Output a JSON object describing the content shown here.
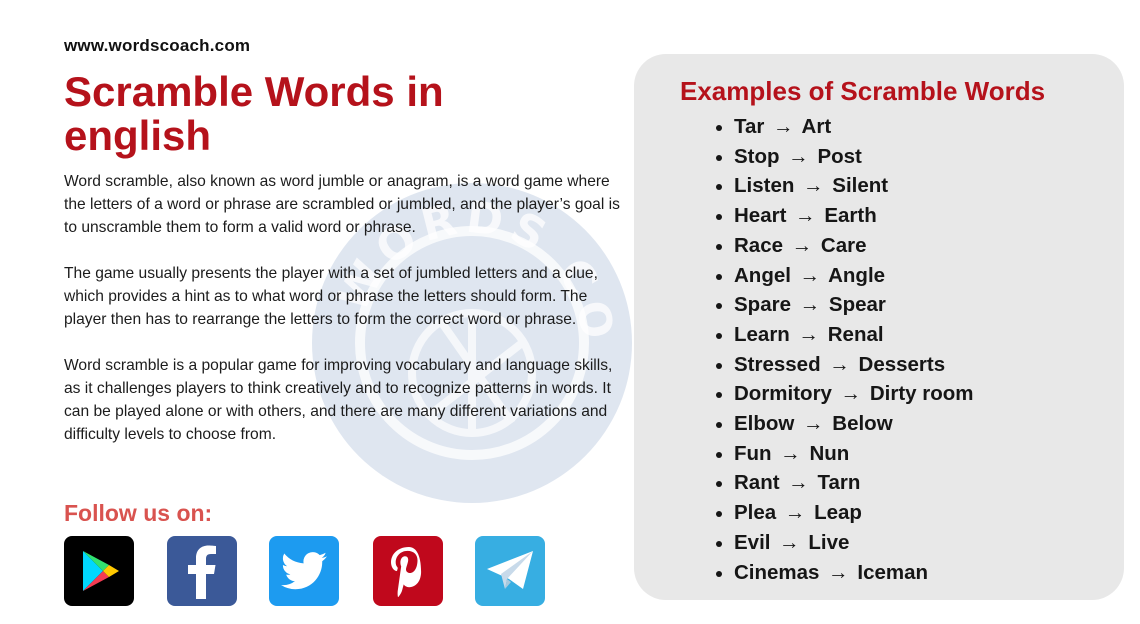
{
  "site": {
    "url": "www.wordscoach.com"
  },
  "header": {
    "title": "Scramble Words in english"
  },
  "article": {
    "paragraphs": [
      "Word scramble, also known as word jumble or anagram, is a word game where the letters of a word or phrase are scrambled or jumbled, and the player’s goal is to unscramble them to form a valid word or phrase.",
      "The game usually presents the player with a set of jumbled letters and a clue, which provides a hint as to what word or phrase the letters should form. The player then has to rearrange the letters to form the correct word or phrase.",
      "Word scramble is a popular game for improving vocabulary and language skills, as it challenges players to think creatively and to recognize patterns in words. It can be played alone or with others, and there are many different variations and difficulty levels to choose from."
    ]
  },
  "follow": {
    "label": "Follow us on:",
    "icons": [
      {
        "name": "google-play-icon",
        "color": "#000000"
      },
      {
        "name": "facebook-icon",
        "color": "#3b5998"
      },
      {
        "name": "twitter-icon",
        "color": "#1d9bf0"
      },
      {
        "name": "pinterest-icon",
        "color": "#c0081c"
      },
      {
        "name": "telegram-icon",
        "color": "#37aee2"
      }
    ]
  },
  "examples": {
    "title": "Examples of Scramble Words",
    "arrow": "→",
    "items": [
      {
        "from": "Tar",
        "to": "Art"
      },
      {
        "from": "Stop",
        "to": "Post"
      },
      {
        "from": "Listen",
        "to": "Silent"
      },
      {
        "from": "Heart",
        "to": "Earth"
      },
      {
        "from": "Race",
        "to": "Care"
      },
      {
        "from": "Angel",
        "to": "Angle"
      },
      {
        "from": "Spare",
        "to": "Spear"
      },
      {
        "from": "Learn",
        "to": "Renal"
      },
      {
        "from": "Stressed",
        "to": "Desserts"
      },
      {
        "from": "Dormitory",
        "to": "Dirty room"
      },
      {
        "from": "Elbow",
        "to": "Below"
      },
      {
        "from": "Fun",
        "to": "Nun"
      },
      {
        "from": "Rant",
        "to": "Tarn"
      },
      {
        "from": "Plea",
        "to": "Leap"
      },
      {
        "from": "Evil",
        "to": "Live"
      },
      {
        "from": "Cinemas",
        "to": "Iceman"
      }
    ]
  },
  "watermark": {
    "text": "WORDS COACH"
  },
  "colors": {
    "accent": "#b5121b",
    "follow": "#d9534f",
    "panel_bg": "#e8e8e8",
    "watermark": "#d6dfec"
  }
}
